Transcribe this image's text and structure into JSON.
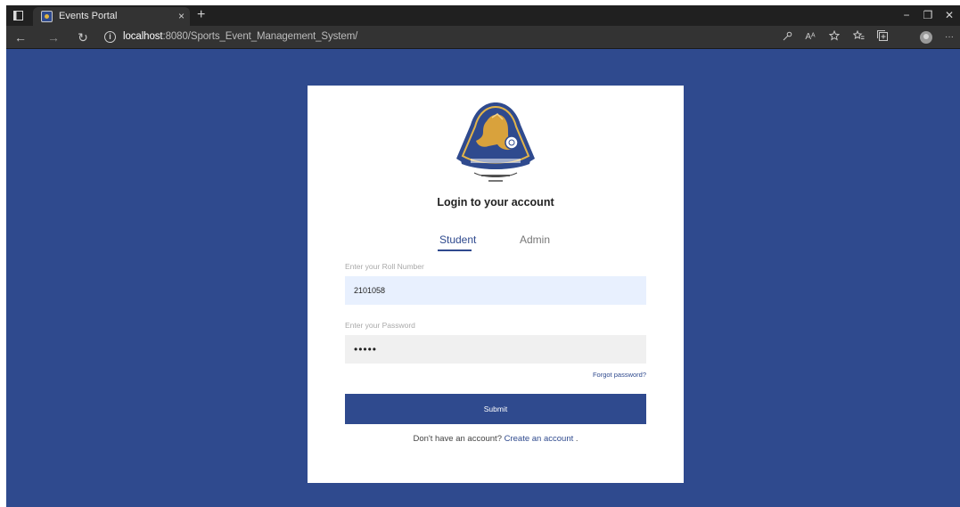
{
  "browser": {
    "tab_title": "Events Portal",
    "url_host": "localhost",
    "url_rest": ":8080/Sports_Event_Management_System/",
    "icons": {
      "workspaces": "square-icon",
      "close_tab": "×",
      "new_tab": "+",
      "back": "←",
      "forward": "→",
      "refresh": "↻",
      "info": "i",
      "minimize": "−",
      "restore": "❐",
      "close_window": "✕",
      "read_aloud": "Aᴬ",
      "more": "···"
    }
  },
  "login": {
    "heading": "Login to your account",
    "tabs": {
      "student": "Student",
      "admin": "Admin"
    },
    "roll_label": "Enter your Roll Number",
    "roll_value": "2101058",
    "password_label": "Enter your Password",
    "password_value": "•••••",
    "forgot": "Forgot password?",
    "submit": "Submit",
    "signup_prompt": "Don't have an account?",
    "signup_link": "Create an account",
    "signup_suffix": " ."
  },
  "colors": {
    "brand": "#2f4a8e",
    "page_bg": "#2f4a8e",
    "input_autofill": "#e8f0fe",
    "input_bg": "#f0f0f0"
  }
}
